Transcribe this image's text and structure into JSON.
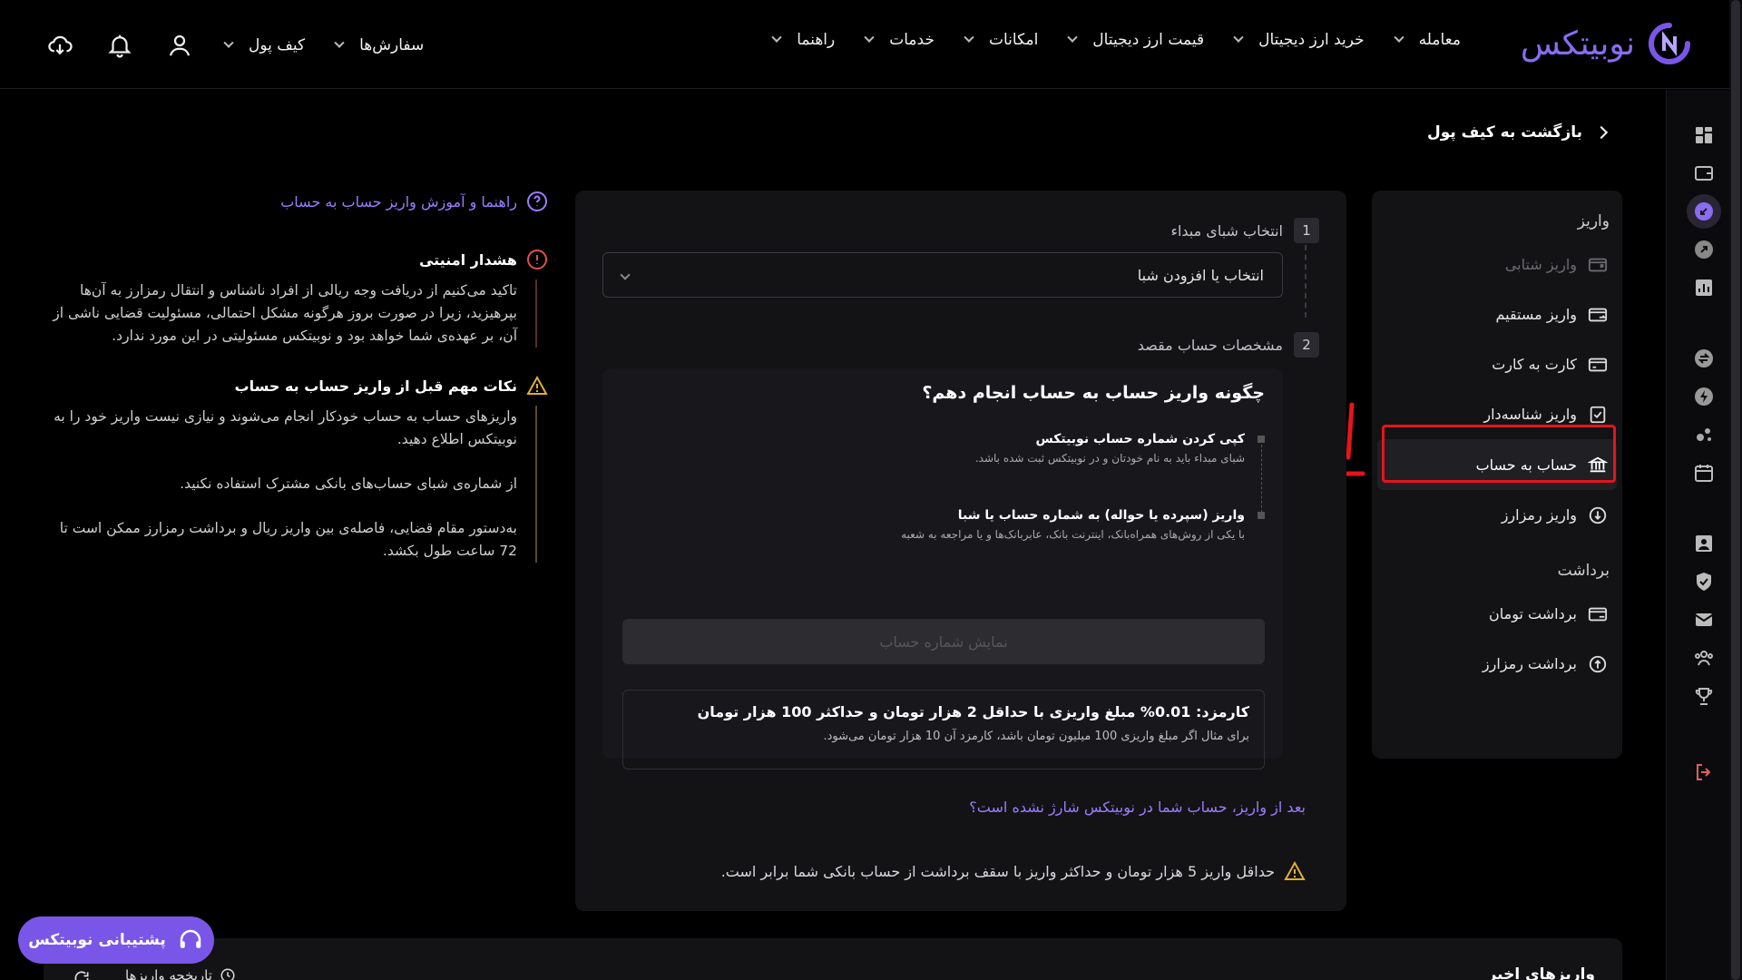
{
  "header": {
    "logo_text": "نوبیتکس",
    "nav": [
      {
        "label": "معامله"
      },
      {
        "label": "خرید ارز دیجیتال"
      },
      {
        "label": "قیمت ارز دیجیتال"
      },
      {
        "label": "امکانات"
      },
      {
        "label": "خدمات"
      },
      {
        "label": "راهنما"
      }
    ],
    "wallet_label": "کیف پول",
    "orders_label": "سفارش‌ها"
  },
  "back_label": "بازگشت به کیف پول",
  "sidebar": {
    "deposit_title": "واریز",
    "deposit_items": [
      {
        "label": "واریز شتابی",
        "icon": "card-arrow-icon",
        "disabled": true
      },
      {
        "label": "واریز مستقیم",
        "icon": "card-sync-icon"
      },
      {
        "label": "کارت به کارت",
        "icon": "card-icon"
      },
      {
        "label": "واریز شناسه‌دار",
        "icon": "check-doc-icon"
      },
      {
        "label": "حساب به حساب",
        "icon": "bank-icon",
        "active": true
      },
      {
        "label": "واریز رمزارز",
        "icon": "crypto-down-icon"
      }
    ],
    "withdraw_title": "برداشت",
    "withdraw_items": [
      {
        "label": "برداشت تومان",
        "icon": "card-out-icon"
      },
      {
        "label": "برداشت رمزارز",
        "icon": "crypto-up-icon"
      }
    ]
  },
  "main": {
    "step1_num": "1",
    "step1_label": "انتخاب شبای مبداء",
    "select_value": "انتخاب یا افزودن شبا",
    "step2_num": "2",
    "step2_label": "مشخصات حساب مقصد",
    "how_title": "چگونه واریز حساب به حساب انجام دهم؟",
    "steps": [
      {
        "title": "کپی کردن شماره حساب نوبیتکس",
        "desc": "شبای مبداء باید به نام خودتان و در نوبیتکس ثبت شده باشد."
      },
      {
        "title": "واریز (سپرده یا حواله) به شماره حساب یا شبا",
        "desc": "با یکی از روش‌های همراه‌بانک، اینترنت بانک، عابربانک‌ها و یا مراجعه به شعبه"
      }
    ],
    "show_button": "نمایش شماره حساب",
    "fee_title": "کارمزد: 0.01% مبلغ واریزی با حداقل 2 هزار تومان و حداکثر 100 هزار تومان",
    "fee_desc": "برای مثال اگر مبلغ واریزی 100 میلیون تومان باشد، کارمزد آن 10 هزار تومان می‌شود.",
    "help_link": "بعد از واریز، حساب شما در نوبیتکس شارژ نشده است؟",
    "note": "حداقل واریز 5 هزار تومان و حداکثر واریز با سقف برداشت از حساب بانکی شما برابر است."
  },
  "left": {
    "guide_link": "راهنما و آموزش واریز حساب به حساب",
    "security_title": "هشدار امنیتی",
    "security_body": "تاکید می‌کنیم از دریافت وجه ریالی از افراد ناشناس و انتقال رمزارز به آن‌ها بپرهیزید، زیرا در صورت بروز هرگونه مشکل احتمالی، مسئولیت قضایی ناشی از آن، بر عهده‌ی شما خواهد بود و نوبیتکس مسئولیتی در این مورد ندارد.",
    "tips_title": "نکات مهم قبل از واریز حساب به حساب",
    "tips": [
      "واریزهای حساب به حساب خودکار انجام می‌شوند و نیازی نیست واریز خود را به نوبیتکس اطلاع دهید.",
      "از شماره‌ی شبای حساب‌های بانکی مشترک استفاده نکنید.",
      "به‌دستور مقام قضایی، فاصله‌ی بین واریز ریال و برداشت رمزارز ممکن است تا 72 ساعت طول بکشد."
    ]
  },
  "bottom": {
    "title": "واریزهای اخیر",
    "history_link": "تاریخچه واریزها"
  },
  "support_label": "پشتیبانی نوبیتکس",
  "colors": {
    "accent": "#7a56e8",
    "link": "#9d7cff",
    "highlight": "#e5141c"
  }
}
